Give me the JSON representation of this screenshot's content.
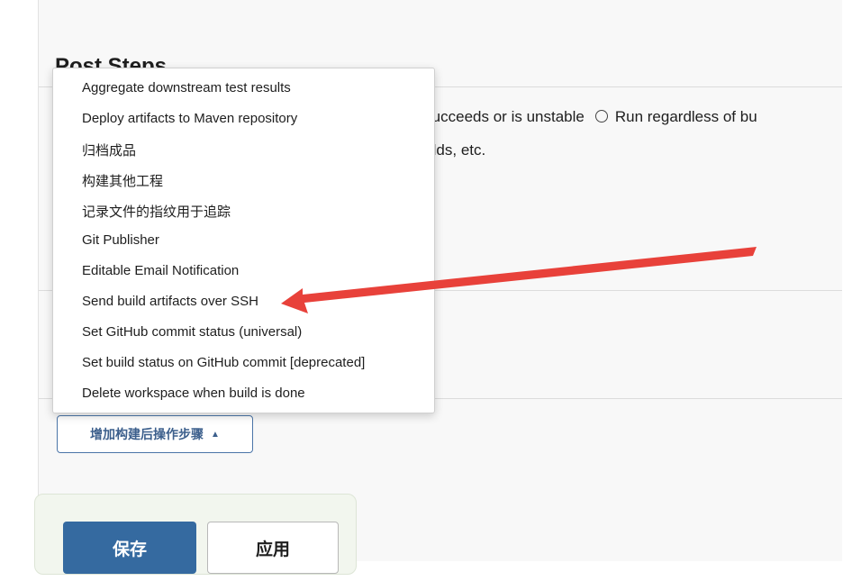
{
  "section": {
    "title": "Post Steps",
    "radio_line": "uild succeeds or is unstable",
    "radio_line_2": "Run regardless of bu",
    "sub_line": "ul builds, etc."
  },
  "dropdown": {
    "items": [
      "Aggregate downstream test results",
      "Deploy artifacts to Maven repository",
      "归档成品",
      "构建其他工程",
      "记录文件的指纹用于追踪",
      "Git Publisher",
      "Editable Email Notification",
      "Send build artifacts over SSH",
      "Set GitHub commit status (universal)",
      "Set build status on GitHub commit [deprecated]",
      "Delete workspace when build is done"
    ]
  },
  "buttons": {
    "add_post_step": "增加构建后操作步骤",
    "save": "保存",
    "apply": "应用"
  },
  "annotation": {
    "arrow_color": "#e8413a"
  }
}
